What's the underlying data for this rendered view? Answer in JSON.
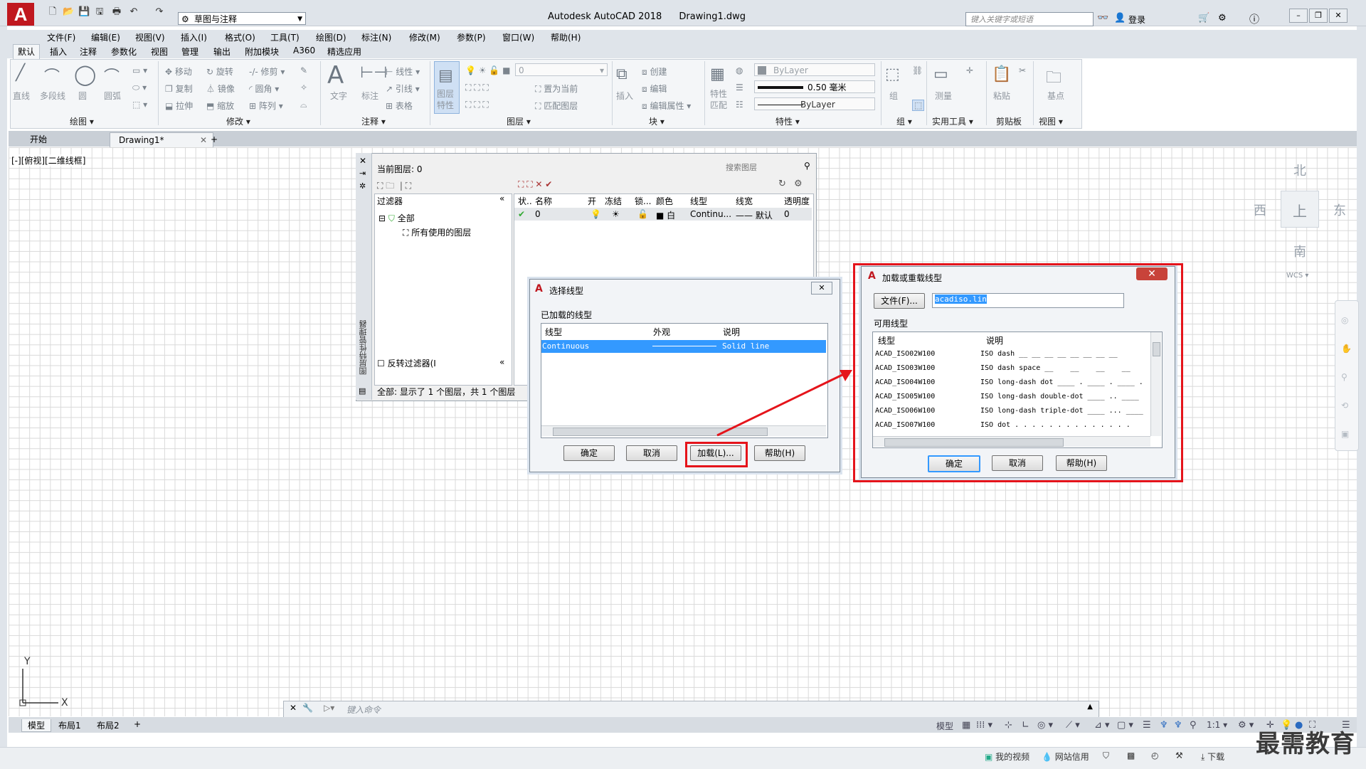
{
  "titlebar": {
    "workspace": "草图与注释",
    "app_title": "Autodesk AutoCAD 2018",
    "doc_title": "Drawing1.dwg",
    "search_placeholder": "键入关键字或短语",
    "login": "登录"
  },
  "menus": [
    "文件(F)",
    "编辑(E)",
    "视图(V)",
    "插入(I)",
    "格式(O)",
    "工具(T)",
    "绘图(D)",
    "标注(N)",
    "修改(M)",
    "参数(P)",
    "窗口(W)",
    "帮助(H)"
  ],
  "ribbon_tabs": [
    "默认",
    "插入",
    "注释",
    "参数化",
    "视图",
    "管理",
    "输出",
    "附加模块",
    "A360",
    "精选应用"
  ],
  "ribbon": {
    "draw": {
      "title": "绘图 ▾",
      "line": "直线",
      "polyline": "多段线",
      "circle": "圆",
      "arc": "圆弧"
    },
    "modify": {
      "title": "修改 ▾",
      "move": "移动",
      "rotate": "旋转",
      "trim": "修剪",
      "copy": "复制",
      "mirror": "镜像",
      "fillet": "圆角",
      "stretch": "拉伸",
      "scale": "缩放",
      "array": "阵列"
    },
    "annotation": {
      "title": "注释 ▾",
      "text": "文字",
      "dimension": "标注",
      "linear": "线性",
      "leader": "引线",
      "table": "表格"
    },
    "layers": {
      "title": "图层 ▾",
      "layer_props": "图层\n特性",
      "current_layer": "0",
      "set_current": "置为当前",
      "match_layer": "匹配图层"
    },
    "block": {
      "title": "块 ▾",
      "insert": "插入",
      "create": "创建",
      "edit": "编辑",
      "edit_attr": "编辑属性"
    },
    "properties": {
      "title": "特性 ▾",
      "match": "特性\n匹配",
      "color": "ByLayer",
      "lineweight": "0.50 毫米",
      "linetype": "ByLayer"
    },
    "group": {
      "title": "组 ▾",
      "group": "组"
    },
    "utilities": {
      "title": "实用工具 ▾",
      "measure": "测量"
    },
    "clipboard": {
      "title": "剪贴板",
      "paste": "粘贴"
    },
    "view": {
      "title": "视图 ▾",
      "base": "基点"
    }
  },
  "doc_tabs": {
    "start": "开始",
    "drawing": "Drawing1*"
  },
  "viewport_label": "[-][俯视][二维线框]",
  "viewcube": {
    "north": "北",
    "south": "南",
    "east": "东",
    "west": "西",
    "top": "上",
    "wcs": "WCS"
  },
  "layer_palette": {
    "current_layer": "当前图层: 0",
    "search": "搜索图层",
    "filter_header": "过滤器",
    "tree_all": "全部",
    "tree_used": "所有使用的图层",
    "invert_filter": "反转过滤器(I",
    "status_text": "全部: 显示了 1 个图层，共 1 个图层",
    "vertical_title": "图层特性管理器",
    "columns": [
      "状..",
      "名称",
      "开",
      "冻结",
      "锁...",
      "颜色",
      "线型",
      "线宽",
      "透明度"
    ],
    "row": {
      "name": "0",
      "color": "白",
      "linetype": "Continu...",
      "lineweight": "默认",
      "transparency": "0"
    }
  },
  "select_linetype": {
    "title": "选择线型",
    "loaded_label": "已加载的线型",
    "columns": [
      "线型",
      "外观",
      "说明"
    ],
    "row": {
      "linetype": "Continuous",
      "description": "Solid line"
    },
    "buttons": {
      "ok": "确定",
      "cancel": "取消",
      "load": "加载(L)...",
      "help": "帮助(H)"
    }
  },
  "load_linetype": {
    "title": "加载或重载线型",
    "file_button": "文件(F)...",
    "file_name": "acadiso.lin",
    "available_label": "可用线型",
    "columns": [
      "线型",
      "说明"
    ],
    "rows": [
      {
        "name": "ACAD_ISO02W100",
        "desc": "ISO dash __ __ __ __ __ __ __ __"
      },
      {
        "name": "ACAD_ISO03W100",
        "desc": "ISO dash space __    __    __    __"
      },
      {
        "name": "ACAD_ISO04W100",
        "desc": "ISO long-dash dot ____ . ____ . ____ ."
      },
      {
        "name": "ACAD_ISO05W100",
        "desc": "ISO long-dash double-dot ____ .. ____"
      },
      {
        "name": "ACAD_ISO06W100",
        "desc": "ISO long-dash triple-dot ____ ... ____"
      },
      {
        "name": "ACAD_ISO07W100",
        "desc": "ISO dot . . . . . . . . . . . . . ."
      }
    ],
    "buttons": {
      "ok": "确定",
      "cancel": "取消",
      "help": "帮助(H)"
    }
  },
  "command": {
    "placeholder": "键入命令"
  },
  "layout_tabs": [
    "模型",
    "布局1",
    "布局2"
  ],
  "status": {
    "model": "模型",
    "scale": "1:1"
  },
  "taskbar": {
    "video": "我的视频",
    "credit": "网站信用",
    "download": "下载"
  },
  "watermark": "最需教育",
  "colors": {
    "accent_red": "#e5141b",
    "selection_blue": "#3399ff",
    "brand_red": "#c0181f"
  }
}
